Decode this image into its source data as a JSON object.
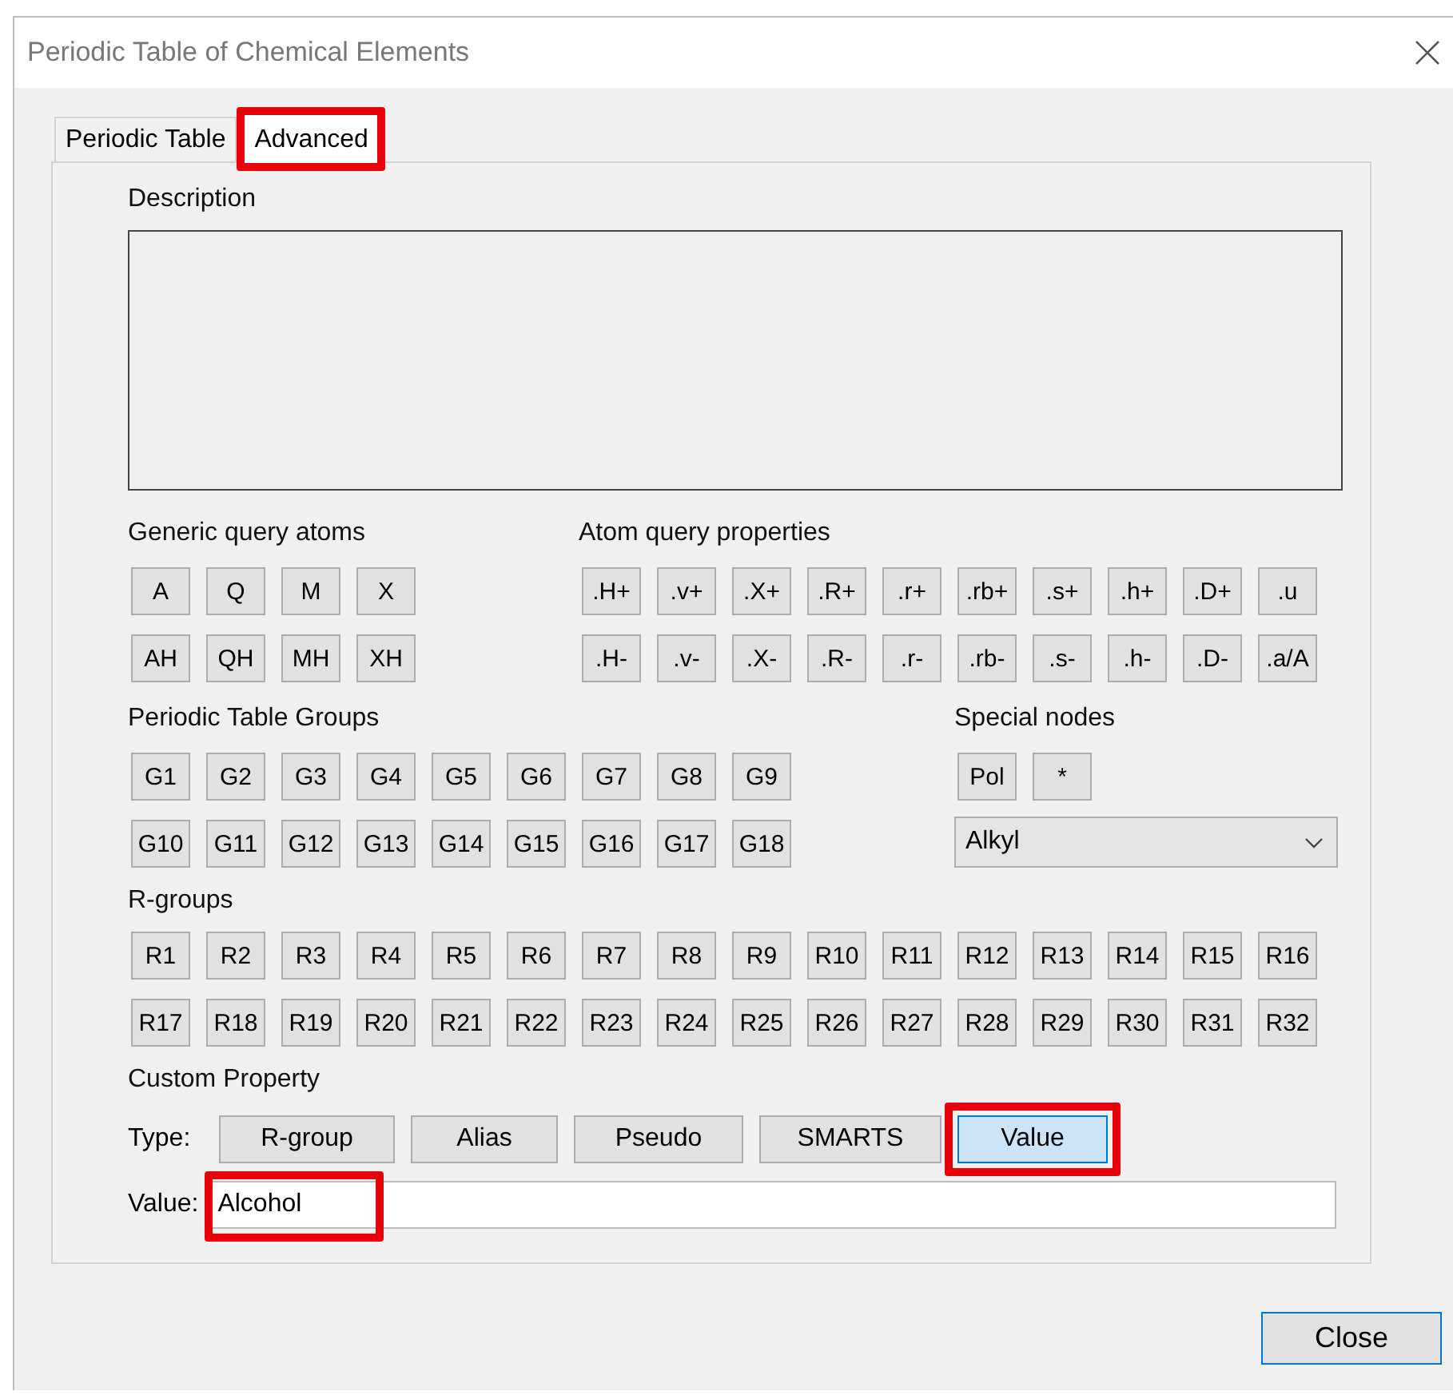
{
  "window": {
    "title": "Periodic Table of Chemical Elements"
  },
  "tabs": [
    {
      "label": "Periodic Table",
      "selected": false,
      "highlighted": false
    },
    {
      "label": "Advanced",
      "selected": true,
      "highlighted": true
    }
  ],
  "description": {
    "label": "Description"
  },
  "generic_query_atoms": {
    "label": "Generic query atoms",
    "rows": [
      [
        "A",
        "Q",
        "M",
        "X"
      ],
      [
        "AH",
        "QH",
        "MH",
        "XH"
      ]
    ]
  },
  "atom_query_properties": {
    "label": "Atom query properties",
    "rows": [
      [
        ".H+",
        ".v+",
        ".X+",
        ".R+",
        ".r+",
        ".rb+",
        ".s+",
        ".h+",
        ".D+",
        ".u"
      ],
      [
        ".H-",
        ".v-",
        ".X-",
        ".R-",
        ".r-",
        ".rb-",
        ".s-",
        ".h-",
        ".D-",
        ".a/A"
      ]
    ]
  },
  "periodic_table_groups": {
    "label": "Periodic Table Groups",
    "rows": [
      [
        "G1",
        "G2",
        "G3",
        "G4",
        "G5",
        "G6",
        "G7",
        "G8",
        "G9"
      ],
      [
        "G10",
        "G11",
        "G12",
        "G13",
        "G14",
        "G15",
        "G16",
        "G17",
        "G18"
      ]
    ]
  },
  "special_nodes": {
    "label": "Special nodes",
    "buttons": [
      "Pol",
      "*"
    ],
    "dropdown": {
      "value": "Alkyl"
    }
  },
  "r_groups": {
    "label": "R-groups",
    "rows": [
      [
        "R1",
        "R2",
        "R3",
        "R4",
        "R5",
        "R6",
        "R7",
        "R8",
        "R9",
        "R10",
        "R11",
        "R12",
        "R13",
        "R14",
        "R15",
        "R16"
      ],
      [
        "R17",
        "R18",
        "R19",
        "R20",
        "R21",
        "R22",
        "R23",
        "R24",
        "R25",
        "R26",
        "R27",
        "R28",
        "R29",
        "R30",
        "R31",
        "R32"
      ]
    ]
  },
  "custom_property": {
    "label": "Custom Property",
    "type_label": "Type:",
    "types": [
      {
        "label": "R-group",
        "selected": false,
        "highlighted": false
      },
      {
        "label": "Alias",
        "selected": false,
        "highlighted": false
      },
      {
        "label": "Pseudo",
        "selected": false,
        "highlighted": false
      },
      {
        "label": "SMARTS",
        "selected": false,
        "highlighted": false
      },
      {
        "label": "Value",
        "selected": true,
        "highlighted": true
      }
    ],
    "value_label": "Value:",
    "value": "Alcohol",
    "value_highlighted": true
  },
  "buttons": [
    "Close"
  ]
}
